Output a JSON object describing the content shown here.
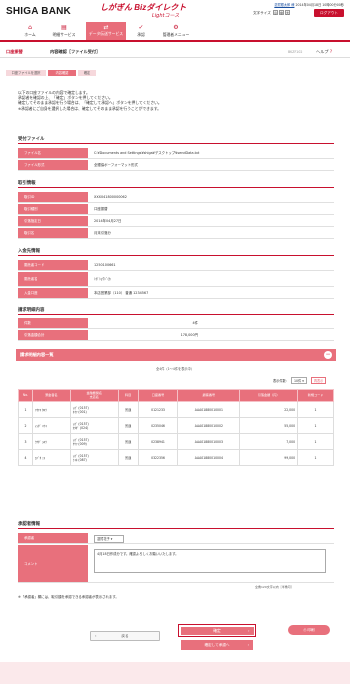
{
  "header": {
    "bank_name": "SHIGA BANK",
    "service_name": "しがぎん Bizダイレクト",
    "service_sub": "Lightコース",
    "user_line": "滋賀銀太郎 様",
    "last_login": "2014年04月18日 10時00分00秒",
    "text_size_label": "文字サイズ",
    "text_size_options": [
      "小",
      "中",
      "大"
    ],
    "logout_label": "ログアウト"
  },
  "nav": [
    {
      "label": "ホーム",
      "icon": "home-icon",
      "glyph": "⌂"
    },
    {
      "label": "明細サービス",
      "icon": "document-icon",
      "glyph": "▤"
    },
    {
      "label": "データ伝送サービス",
      "icon": "transfer-icon",
      "glyph": "⇄"
    },
    {
      "label": "承認",
      "icon": "approve-icon",
      "glyph": "✓"
    },
    {
      "label": "管理者メニュー",
      "icon": "admin-icon",
      "glyph": "⚙"
    }
  ],
  "page": {
    "crumb_section": "口座振替",
    "title": "内容確認［ファイル受付］",
    "screen_id": "BKZF102",
    "help_label": "ヘルプ"
  },
  "steps": [
    "口座ファイルを選択",
    "内容確認",
    "確定"
  ],
  "intro_lines": [
    "以下の口座ファイルの内容で確定します。",
    "承認者を確認の上、「確定」ボタンを押してください。",
    "確定してそのまま承認を行う場合は、「確定して承認へ」ボタンを押してください。",
    "※承認者にご自身を選択した場合は、確定してそのまま承認を行うことができます。"
  ],
  "file": {
    "title": "受付ファイル",
    "rows": [
      {
        "k": "ファイル名",
        "v": "C:¥Documents and Settings¥shiga¥デスクトップ¥sendData.txt"
      },
      {
        "k": "ファイル形式",
        "v": "全銀協ポーフォーマット形式"
      }
    ]
  },
  "transaction": {
    "title": "取引情報",
    "rows": [
      {
        "k": "取引ID",
        "v": "XXX041800000062"
      },
      {
        "k": "取引種別",
        "v": "口座振替"
      },
      {
        "k": "引落指定日",
        "v": "2014年04月27日"
      },
      {
        "k": "取引名",
        "v": "月末引落分"
      }
    ]
  },
  "collector": {
    "title": "入金先情報",
    "rows": [
      {
        "k": "委託者コード",
        "v": "1250100661"
      },
      {
        "k": "委託者名",
        "v": "ｼｶﾞｼｮｳｼﾞ(ｶ"
      },
      {
        "k": "入金口座",
        "v": "本店営業部（110） 普通 1234567"
      }
    ]
  },
  "billing": {
    "title": "請求明細内容",
    "rows": [
      {
        "k": "件数",
        "v": "4件"
      },
      {
        "k": "引落金額合計",
        "v": "178,000円"
      }
    ]
  },
  "list": {
    "title": "請求明細内容一覧",
    "count_text": "全4件（1〜4件を表示中）",
    "per_page_label": "表示件数：",
    "per_page_value": "10件",
    "reload_label": "再表示",
    "headers": [
      "No.",
      "預金者名",
      "金融機関名\n支店名",
      "科目",
      "口座番号",
      "顧客番号",
      "引落金額（円）",
      "新規コード"
    ],
    "rows": [
      [
        "1",
        "ｱｵﾔﾏ ﾀﾛｳ",
        "ｼｶﾞ (0157)\nｵｵﾂ (001)",
        "普通",
        "0121233",
        "AAA01880010001",
        "22,000",
        "1"
      ],
      [
        "2",
        "ｲｼﾀﾞ ﾊﾅｺ",
        "ｼｶﾞ (0157)\nｶﾀﾀﾞ (024)",
        "普通",
        "0235046",
        "AAA01880010002",
        "55,000",
        "1"
      ],
      [
        "3",
        "ｳﾁﾀﾞ ｼﾛｳ",
        "ｼｶﾞ (0157)\nｸｻﾂ (009)",
        "普通",
        "0238941",
        "AAA01880010003",
        "7,000",
        "1"
      ],
      [
        "4",
        "ｴﾊﾞﾀ ﾐｷ",
        "ｼｶﾞ (0157)\nﾋｺﾈ (087)",
        "普通",
        "0322356",
        "AAA01880010004",
        "99,000",
        "1"
      ]
    ]
  },
  "approval": {
    "title": "承認者情報",
    "approver_label": "承認者",
    "approver_value": "滋賀花子",
    "comment_label": "コメント",
    "comment_value": "4月18日作成分です。確認よろしくお願いいたします。",
    "comment_note": "全角120文字以内［半角可］"
  },
  "note": "※「承認者」欄には、取引額を承認できる承認者が表示されます。",
  "buttons": {
    "back": "戻る",
    "confirm": "確定",
    "confirm_approve": "確定して承認へ",
    "print": "印刷"
  },
  "colors": {
    "brand": "#c8102e",
    "accent": "#e8707c"
  }
}
